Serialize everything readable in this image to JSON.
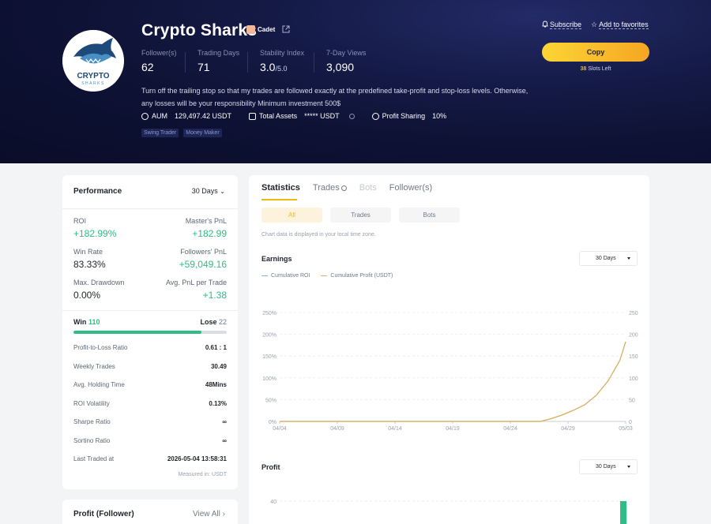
{
  "trader": {
    "name": "Crypto Sharks",
    "badge": "Cadet",
    "logo_text_1": "CRYPTO",
    "logo_text_2": "SHARKS",
    "stats": [
      {
        "label": "Follower(s)",
        "value": "62"
      },
      {
        "label": "Trading Days",
        "value": "71"
      },
      {
        "label": "Stability Index",
        "value": "3.0",
        "suffix": "/5.0"
      },
      {
        "label": "7-Day Views",
        "value": "3,090"
      }
    ],
    "description": "Turn off the trailing stop so that my trades are followed exactly at the predefined take-profit and stop-loss levels. Otherwise, any losses will be your responsibility Minimum investment 500$",
    "aum_label": "AUM",
    "aum_value": "129,497.42 USDT",
    "total_assets_label": "Total Assets",
    "total_assets_value": "***** USDT",
    "profit_sharing_label": "Profit Sharing",
    "profit_sharing_value": "10%",
    "tags": [
      "Swing Trader",
      "Money Maker"
    ]
  },
  "actions": {
    "subscribe": "Subscribe",
    "favorites": "Add to favorites",
    "copy": "Copy",
    "slots_count": "38",
    "slots_text": "Slots Left"
  },
  "performance": {
    "title": "Performance",
    "period": "30 Days",
    "metrics": [
      {
        "label": "ROI",
        "value": "+182.99%"
      },
      {
        "label": "Master's PnL",
        "value": "+182.99"
      },
      {
        "label": "Win Rate",
        "value": "83.33%"
      },
      {
        "label": "Followers' PnL",
        "value": "+59,049.16"
      },
      {
        "label": "Max. Drawdown",
        "value": "0.00%"
      },
      {
        "label": "Avg. PnL per Trade",
        "value": "+1.38"
      }
    ],
    "win_label": "Win",
    "win_count": "110",
    "lose_label": "Lose",
    "lose_count": "22",
    "win_ratio": 0.833,
    "rows": [
      {
        "label": "Profit-to-Loss Ratio",
        "value": "0.61 : 1"
      },
      {
        "label": "Weekly Trades",
        "value": "30.49"
      },
      {
        "label": "Avg. Holding Time",
        "value": "48Mins"
      },
      {
        "label": "ROI Volatility",
        "value": "0.13%"
      },
      {
        "label": "Sharpe Ratio",
        "value": "∞"
      },
      {
        "label": "Sortino Ratio",
        "value": "∞"
      },
      {
        "label": "Last Traded at",
        "value": "2026-05-04 13:58:31"
      }
    ],
    "measured": "Measured in: USDT"
  },
  "profit_follower": {
    "title": "Profit (Follower)",
    "view_all": "View All"
  },
  "tabs": [
    {
      "label": "Statistics",
      "state": "active"
    },
    {
      "label": "Trades",
      "state": "normal"
    },
    {
      "label": "Bots",
      "state": "disabled"
    },
    {
      "label": "Follower(s)",
      "state": "normal"
    }
  ],
  "segments": [
    "All",
    "Trades",
    "Bots"
  ],
  "note": "Chart data is displayed in your local time zone.",
  "earnings": {
    "title": "Earnings",
    "period": "30 Days",
    "legend_roi": "Cumulative ROI",
    "legend_profit": "Cumulative Profit (USDT)"
  },
  "profit_section": {
    "title": "Profit",
    "period": "30 Days"
  },
  "colors": {
    "accent": "#f0b90b",
    "green": "#2ebd85",
    "roi_line": "#7fb5f0",
    "profit_line": "#d9b26a"
  },
  "chart_data": [
    {
      "type": "line",
      "title": "Earnings",
      "x_ticks": [
        "04/04",
        "04/09",
        "04/14",
        "04/19",
        "04/24",
        "04/29",
        "05/03"
      ],
      "y_left_ticks": [
        "0%",
        "50%",
        "100%",
        "150%",
        "200%",
        "250%"
      ],
      "y_right_ticks": [
        "0",
        "50",
        "100",
        "150",
        "200",
        "250"
      ],
      "ylim": [
        0,
        250
      ],
      "series": [
        {
          "name": "Cumulative Profit (USDT)",
          "x": [
            0,
            4,
            8,
            12,
            16,
            20,
            22.2,
            23,
            24,
            25,
            26,
            27,
            28,
            29,
            29.5
          ],
          "values": [
            0,
            0,
            0,
            0,
            0,
            0,
            0,
            5,
            14,
            25,
            38,
            60,
            93,
            140,
            183
          ]
        }
      ]
    },
    {
      "type": "bar",
      "title": "Profit",
      "y_ticks": [
        "40"
      ],
      "ylim": [
        0,
        50
      ],
      "values_note": "",
      "values": [
        3,
        40
      ]
    }
  ]
}
